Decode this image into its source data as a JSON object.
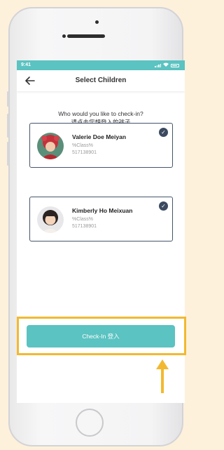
{
  "status_bar": {
    "time": "9:41"
  },
  "header": {
    "back_icon": "arrow-left-icon",
    "title": "Select Children"
  },
  "prompt": {
    "line_en": "Who would you like to check-in?",
    "line_zh": "请点击您想登入的孩子"
  },
  "children": [
    {
      "name": "Valerie Doe Meiyan",
      "class": "%Class%",
      "id": "517138901",
      "selected": true
    },
    {
      "name": "Kimberly Ho Meixuan",
      "class": "%Class%",
      "id": "517138901",
      "selected": true
    }
  ],
  "checkin_button": {
    "label": "Check-In  登入"
  },
  "colors": {
    "accent": "#5bc3c1",
    "card_border": "#45556b",
    "highlight": "#f2b930",
    "background": "#fdf1dc"
  }
}
